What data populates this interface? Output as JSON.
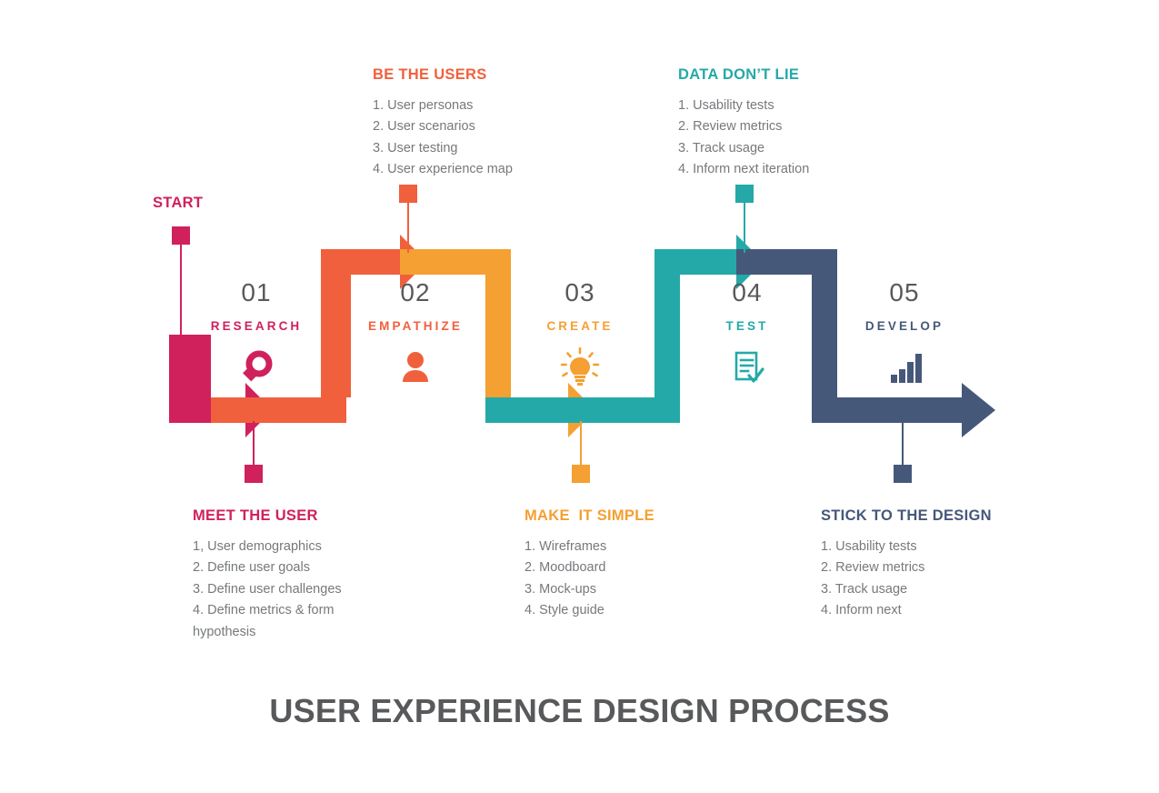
{
  "title": "USER EXPERIENCE DESIGN PROCESS",
  "start_label": "START",
  "colors": {
    "crimson": "#D0215C",
    "orange_red": "#F1603C",
    "amber": "#F4A032",
    "teal": "#24A9A8",
    "navy": "#46587A",
    "body_text": "#76797c",
    "number": "#58595b"
  },
  "steps": [
    {
      "number": "01",
      "label": "RESEARCH",
      "icon": "magnifier-icon",
      "color": "#D0215C"
    },
    {
      "number": "02",
      "label": "EMPATHIZE",
      "icon": "person-icon",
      "color": "#F1603C"
    },
    {
      "number": "03",
      "label": "CREATE",
      "icon": "lightbulb-icon",
      "color": "#F4A032"
    },
    {
      "number": "04",
      "label": "TEST",
      "icon": "checklist-icon",
      "color": "#24A9A8"
    },
    {
      "number": "05",
      "label": "DEVELOP",
      "icon": "bar-chart-icon",
      "color": "#46587A"
    }
  ],
  "callouts": {
    "top_empathize": {
      "title": "BE THE USERS",
      "color": "#F1603C",
      "items": [
        "1. User personas",
        "2. User scenarios",
        "3. User testing",
        "4. User experience map"
      ]
    },
    "top_test": {
      "title": "DATA DON’T LIE",
      "color": "#24A9A8",
      "items": [
        "1. Usability tests",
        "2. Review metrics",
        "3. Track usage",
        "4. Inform next iteration"
      ]
    },
    "bottom_research": {
      "title": "MEET THE USER",
      "color": "#D0215C",
      "items": [
        "1, User demographics",
        "2. Define user goals",
        "3. Define user challenges",
        "4. Define metrics & form hypothesis"
      ]
    },
    "bottom_create": {
      "title": "MAKE  IT SIMPLE",
      "color": "#F4A032",
      "items": [
        "1. Wireframes",
        "2. Moodboard",
        "3. Mock-ups",
        "4. Style guide"
      ]
    },
    "bottom_develop": {
      "title": "STICK TO THE DESIGN",
      "color": "#46587A",
      "items": [
        "1. Usability tests",
        "2. Review metrics",
        "3. Track usage",
        "4. Inform next"
      ]
    }
  }
}
